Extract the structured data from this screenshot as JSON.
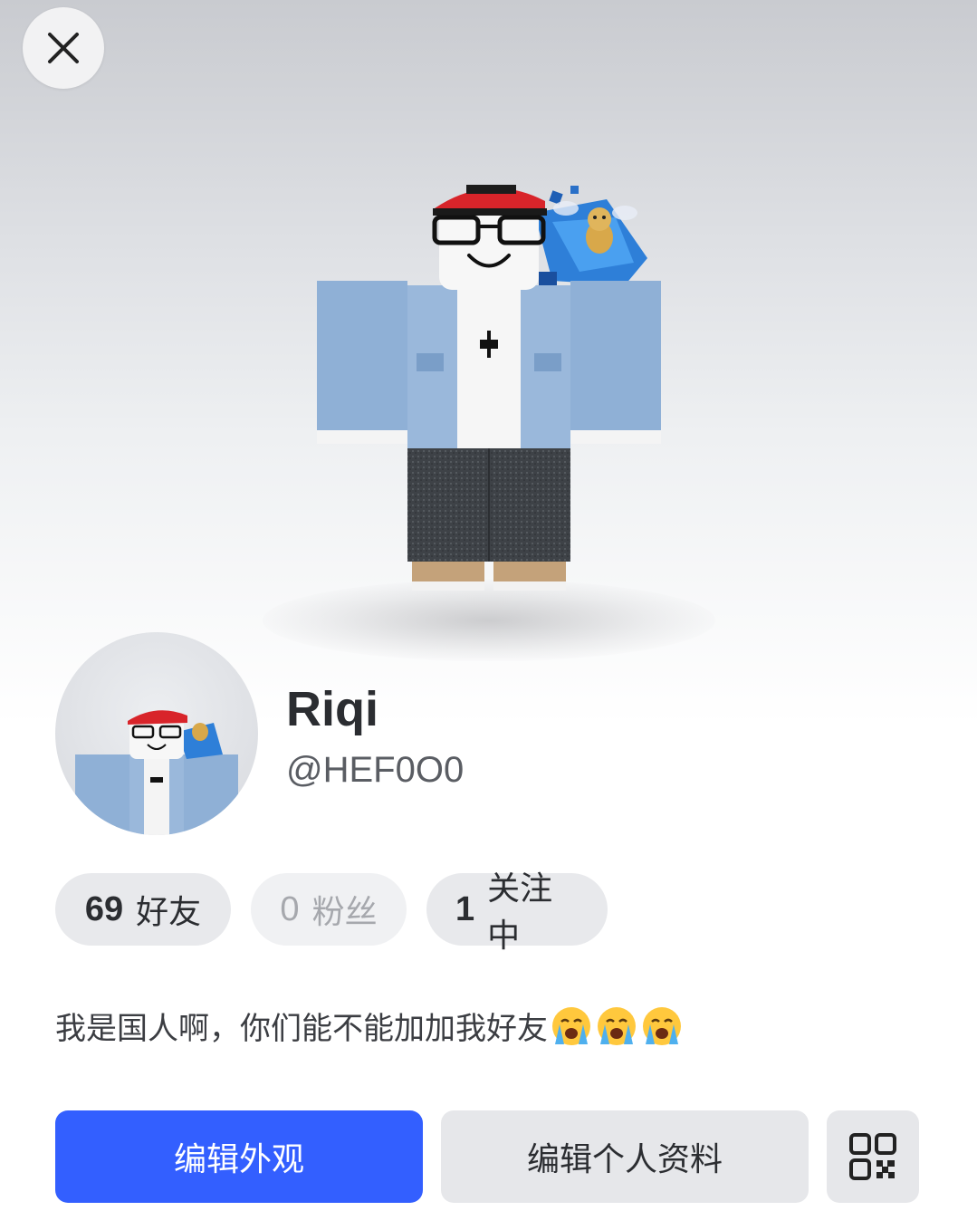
{
  "header": {
    "close_icon": "close-icon"
  },
  "profile": {
    "display_name": "Riqi",
    "username": "@HEF0O0",
    "bio": "我是国人啊，你们能不能加加我好友",
    "bio_emojis": [
      "loudly-crying-face",
      "loudly-crying-face",
      "loudly-crying-face"
    ]
  },
  "stats": {
    "friends": {
      "count": "69",
      "label": "好友"
    },
    "followers": {
      "count": "0",
      "label": "粉丝"
    },
    "following": {
      "count": "1",
      "label": "关注中"
    }
  },
  "actions": {
    "edit_avatar": "编辑外观",
    "edit_profile": "编辑个人资料",
    "qr_icon": "qr-code-icon"
  },
  "colors": {
    "primary": "#335fff",
    "pill_bg": "#e8e9ec",
    "text_dark": "#2b2d31"
  }
}
